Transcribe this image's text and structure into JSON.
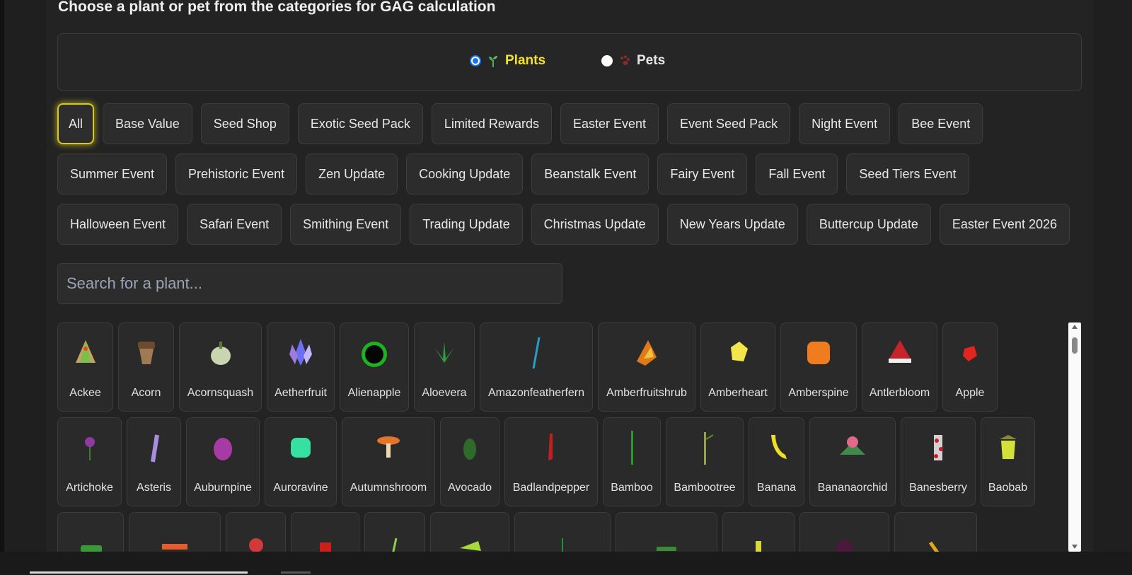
{
  "heading": "Choose a plant or pet from the categories for GAG calculation",
  "type_selector": {
    "options": [
      {
        "label": "Plants",
        "selected": true,
        "icon": "sprout-icon"
      },
      {
        "label": "Pets",
        "selected": false,
        "icon": "paw-icon"
      }
    ]
  },
  "categories": {
    "row1": [
      "All",
      "Base Value",
      "Seed Shop",
      "Exotic Seed Pack",
      "Limited Rewards",
      "Easter Event",
      "Event Seed Pack",
      "Night Event",
      "Bee Event"
    ],
    "row2": [
      "Summer Event",
      "Prehistoric Event",
      "Zen Update",
      "Cooking Update",
      "Beanstalk Event",
      "Fairy Event",
      "Fall Event",
      "Seed Tiers Event"
    ],
    "row3": [
      "Halloween Event",
      "Safari Event",
      "Smithing Event",
      "Trading Update",
      "Christmas Update",
      "New Years Update",
      "Buttercup Update",
      "Easter Event 2026"
    ],
    "active": "All"
  },
  "search": {
    "placeholder": "Search for a plant...",
    "value": ""
  },
  "plants": {
    "row1": [
      "Ackee",
      "Acorn",
      "Acornsquash",
      "Aetherfruit",
      "Alienapple",
      "Aloevera",
      "Amazonfeatherfern",
      "Amberfruitshrub",
      "Amberheart",
      "Amberspine",
      "Antlerbloom",
      "Apple"
    ],
    "row2": [
      "Artichoke",
      "Asteris",
      "Auburnpine",
      "Auroravine",
      "Autumnshroom",
      "Avocado",
      "Badlandpepper",
      "Bamboo",
      "Bambootree",
      "Banana",
      "Bananaorchid",
      "Banesberry",
      "Baobab"
    ],
    "row3": [
      "",
      "",
      "",
      "",
      "",
      "",
      "",
      "",
      "",
      "",
      "",
      ""
    ]
  },
  "colors": {
    "accent_yellow": "#f2e22a",
    "radio_blue": "#1a73e8",
    "panel_bg": "#232323",
    "button_bg": "#2c2c2c"
  }
}
